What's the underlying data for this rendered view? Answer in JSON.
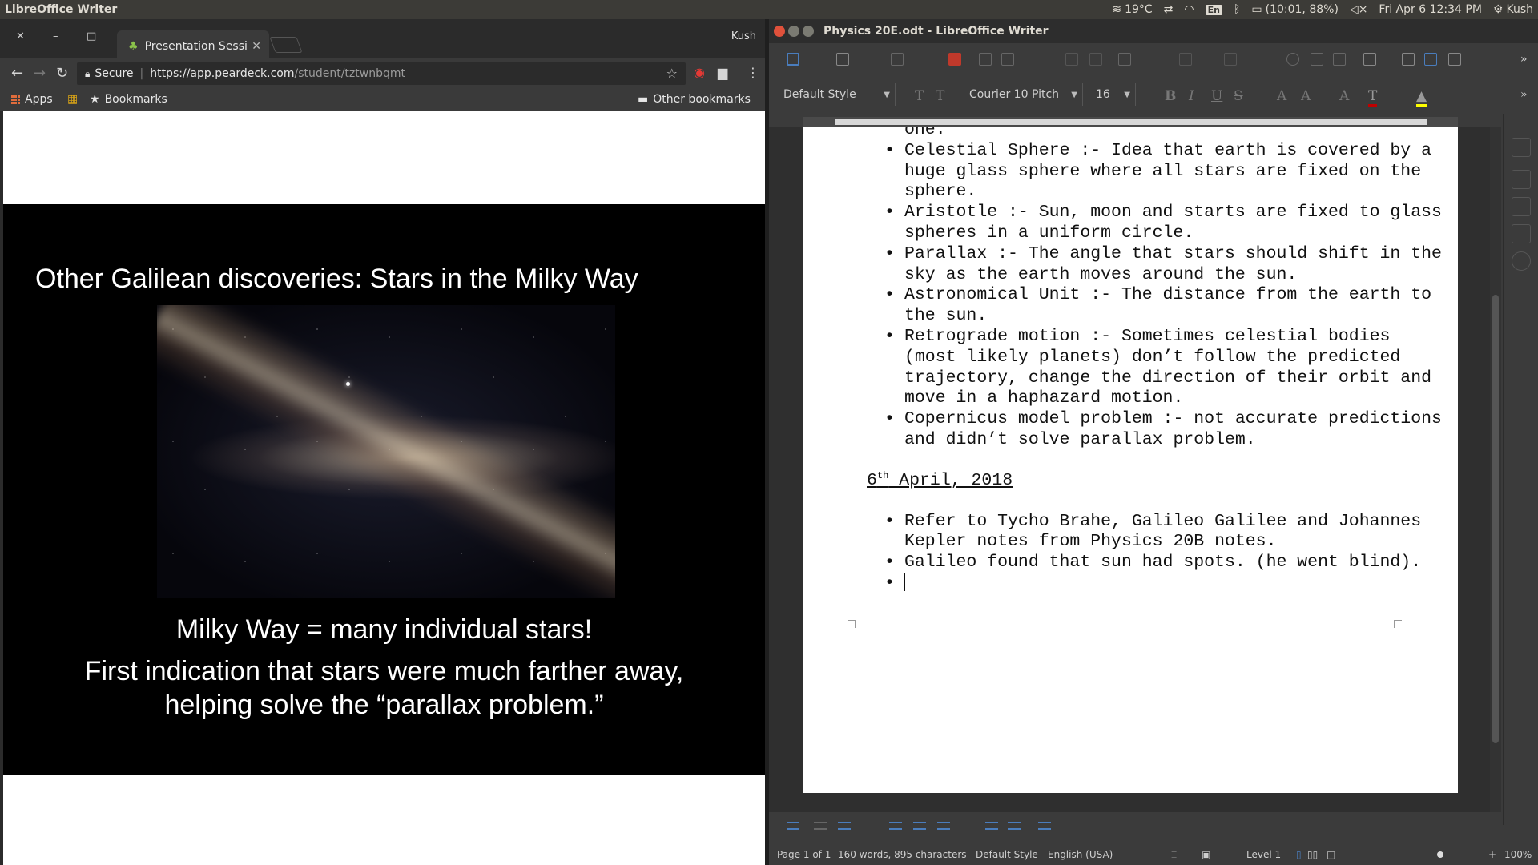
{
  "system": {
    "active_app": "LibreOffice Writer",
    "temperature": "19°C",
    "keyboard": "En",
    "battery": "(10:01, 88%)",
    "datetime": "Fri Apr  6 12:34 PM",
    "user": "Kush"
  },
  "chrome": {
    "tab_title": "Presentation Sessi",
    "profile": "Kush",
    "url_secure": "Secure",
    "url_host": "https://app.peardeck.com",
    "url_path": "/student/tztwnbqmt",
    "bookmarks": {
      "apps": "Apps",
      "bookmarks": "Bookmarks",
      "other": "Other bookmarks"
    }
  },
  "slide": {
    "title": "Other Galilean discoveries: Stars in the Milky Way",
    "line1": "Milky Way = many individual stars!",
    "line2a": "First indication that stars were much farther away,",
    "line2b": "helping solve the “parallax problem.”"
  },
  "writer": {
    "window_title": "Physics 20E.odt - LibreOffice Writer",
    "para_style": "Default Style",
    "font_name": "Courier 10 Pitch",
    "font_size": "16",
    "doc": {
      "frag": "one.",
      "bullets1": [
        "Celestial Sphere :- Idea that earth is covered by a huge glass sphere where all stars are fixed on the sphere.",
        "Aristotle :- Sun, moon and starts are fixed to glass spheres in a uniform circle.",
        "Parallax :- The angle that stars should shift in the sky as the earth moves around the sun.",
        "Astronomical Unit :- The distance from the earth to the sun.",
        "Retrograde motion :- Sometimes celestial bodies (most likely planets) don’t follow the predicted trajectory, change the direction of their orbit and move in a haphazard motion.",
        "Copernicus model problem :- not accurate predictions and didn’t solve parallax problem."
      ],
      "date_day": "6",
      "date_sup": "th",
      "date_rest": " April, 2018",
      "bullets2": [
        "Refer to Tycho Brahe, Galileo Galilee and Johannes Kepler notes from Physics 20B notes.",
        "Galileo found that sun had spots. (he went blind)."
      ]
    },
    "status": {
      "page": "Page 1 of 1",
      "words": "160 words, 895 characters",
      "page_style": "Default Style",
      "language": "English (USA)",
      "outline_level": "Level 1",
      "zoom": "100%"
    }
  }
}
